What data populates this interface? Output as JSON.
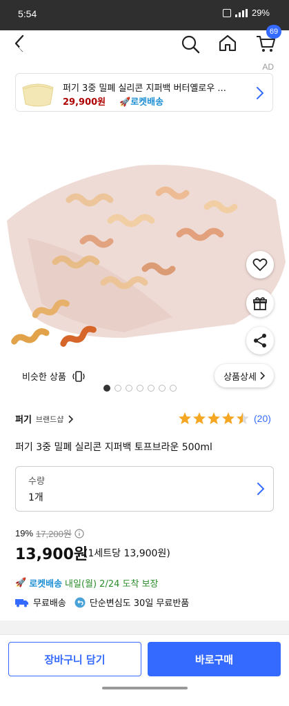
{
  "statusbar": {
    "time": "5:54",
    "battery": "29%"
  },
  "header": {
    "cart_count": "69",
    "ad_label": "AD"
  },
  "ad_banner": {
    "title": "퍼기 3중 밀폐 실리콘 지퍼백 버터옐로우 ...",
    "price": "29,900원",
    "delivery": "로켓배송"
  },
  "gallery": {
    "similar_label": "비슷한 상품",
    "detail_label": "상품상세",
    "page_total": 7,
    "page_active": 1
  },
  "product": {
    "brand": "퍼기",
    "brand_shop": "브랜드샵",
    "rating": 4.5,
    "review_count": "(20)",
    "title": "퍼기 3중 밀폐 실리콘 지퍼백 토프브라운 500ml"
  },
  "quantity": {
    "label": "수량",
    "value": "1개"
  },
  "pricing": {
    "discount": "19%",
    "original": "17,200원",
    "price": "13,900원",
    "unit_price": "(1세트당 13,900원)"
  },
  "delivery": {
    "rocket": "로켓배송",
    "date": "내일(월) 2/24 도착 보장",
    "free_shipping": "무료배송",
    "return_policy": "단순변심도 30일 무료반품"
  },
  "actions": {
    "cart": "장바구니 담기",
    "buy": "바로구매"
  },
  "colors": {
    "accent": "#346aff",
    "price_red": "#ae0000",
    "rocket_blue": "#1b8ed4",
    "star": "#f5a623"
  }
}
